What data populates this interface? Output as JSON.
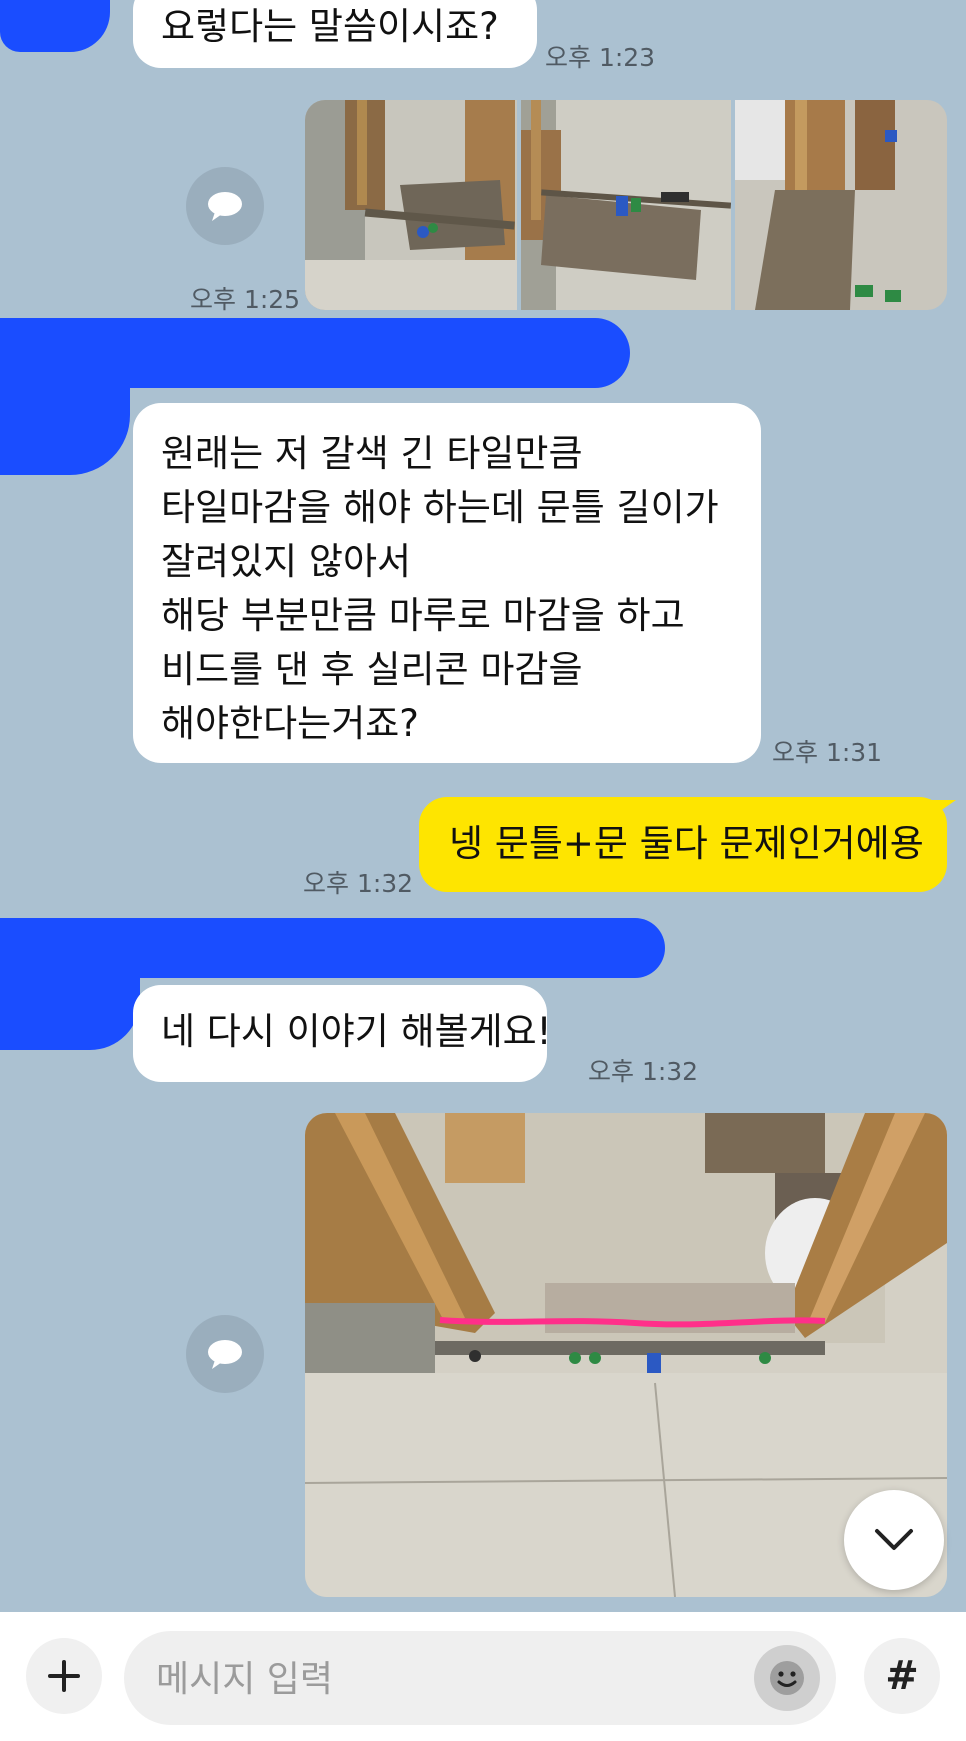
{
  "messages": [
    {
      "id": "m1",
      "sender": "other",
      "text_lines": [
        "요렇다는 말씀이시죠?"
      ],
      "time": "오후 1:23"
    },
    {
      "id": "m2",
      "sender": "me",
      "type": "photos",
      "photo_count": 3,
      "time": "오후 1:25"
    },
    {
      "id": "m3",
      "sender": "other",
      "text_lines": [
        "원래는 저 갈색 긴 타일만큼",
        "타일마감을 해야 하는데 문틀 길이가",
        "잘려있지 않아서",
        "해당 부분만큼 마루로 마감을 하고",
        "비드를 댄 후 실리콘 마감을",
        "해야한다는거죠?"
      ],
      "time": "오후 1:31"
    },
    {
      "id": "m4",
      "sender": "me",
      "text_lines": [
        "넹 문틀+문 둘다 문제인거에용"
      ],
      "time": "오후 1:32"
    },
    {
      "id": "m5",
      "sender": "other",
      "text_lines": [
        "네 다시 이야기 해볼게요!"
      ],
      "time": "오후 1:32"
    },
    {
      "id": "m6",
      "sender": "me",
      "type": "photo",
      "photo_count": 1
    }
  ],
  "composer": {
    "placeholder": "메시지 입력",
    "plus_icon": "plus-icon",
    "emoji_icon": "emoji-icon",
    "hash_icon": "hash-icon",
    "hash_glyph": "#"
  },
  "icons": {
    "share": "share-icon",
    "scroll_down": "chevron-down-icon"
  },
  "colors": {
    "background": "#abc1d1",
    "my_bubble": "#fee500",
    "other_bubble": "#ffffff",
    "redaction": "#1a4dff"
  }
}
